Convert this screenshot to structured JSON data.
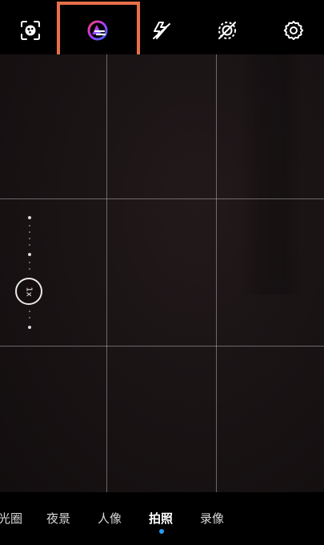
{
  "top_bar": {
    "icons": [
      {
        "name": "smart-lens-icon"
      },
      {
        "name": "ai-assistant-icon",
        "highlighted": true
      },
      {
        "name": "flash-off-icon"
      },
      {
        "name": "live-photo-off-icon"
      },
      {
        "name": "settings-gear-icon"
      }
    ],
    "highlight_color": "#e8704a"
  },
  "viewfinder": {
    "grid": "3x3",
    "zoom_label": "1x"
  },
  "modes": {
    "aperture": "光圈",
    "night": "夜景",
    "portrait": "人像",
    "photo": "拍照",
    "video": "录像",
    "active": "拍照",
    "indicator_color": "#2a9df4"
  }
}
